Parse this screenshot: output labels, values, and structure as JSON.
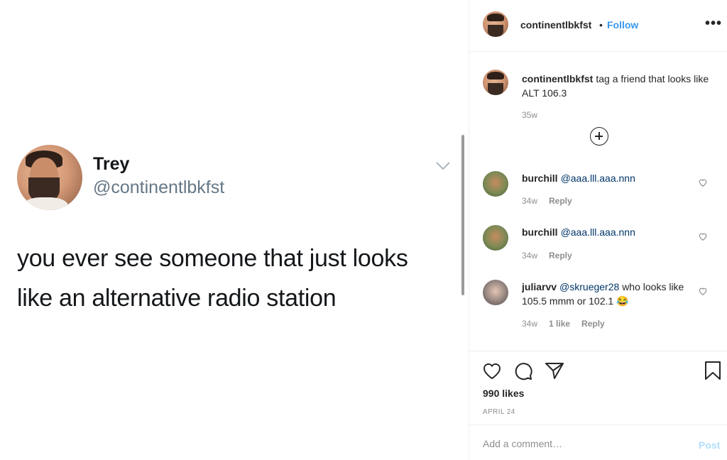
{
  "tweet": {
    "name": "Trey",
    "handle": "@continentlbkfst",
    "line1": "you ever see someone that just looks",
    "line2": "like an alternative radio station"
  },
  "header": {
    "username": "continentlbkfst",
    "separator": "•",
    "follow_label": "Follow",
    "more_label": "•••"
  },
  "caption": {
    "username": "continentlbkfst",
    "text": "tag a friend that looks like ALT 106.3",
    "time": "35w"
  },
  "comments": [
    {
      "username": "burchill",
      "mention": "@aaa.lll.aaa.nnn",
      "text": "",
      "time": "34w",
      "likes": "",
      "reply": "Reply"
    },
    {
      "username": "burchill",
      "mention": "@aaa.lll.aaa.nnn",
      "text": "",
      "time": "34w",
      "likes": "",
      "reply": "Reply"
    },
    {
      "username": "juliarvv",
      "mention": "@skrueger28",
      "text": "who looks like 105.5 mmm or 102.1 😂",
      "time": "34w",
      "likes": "1 like",
      "reply": "Reply"
    }
  ],
  "actions": {
    "likes": "990 likes",
    "date": "APRIL 24"
  },
  "add_comment": {
    "placeholder": "Add a comment…",
    "post_label": "Post"
  },
  "colors": {
    "follow": "#3897f0",
    "mention": "#003569",
    "post_disabled": "#b2dffc"
  }
}
